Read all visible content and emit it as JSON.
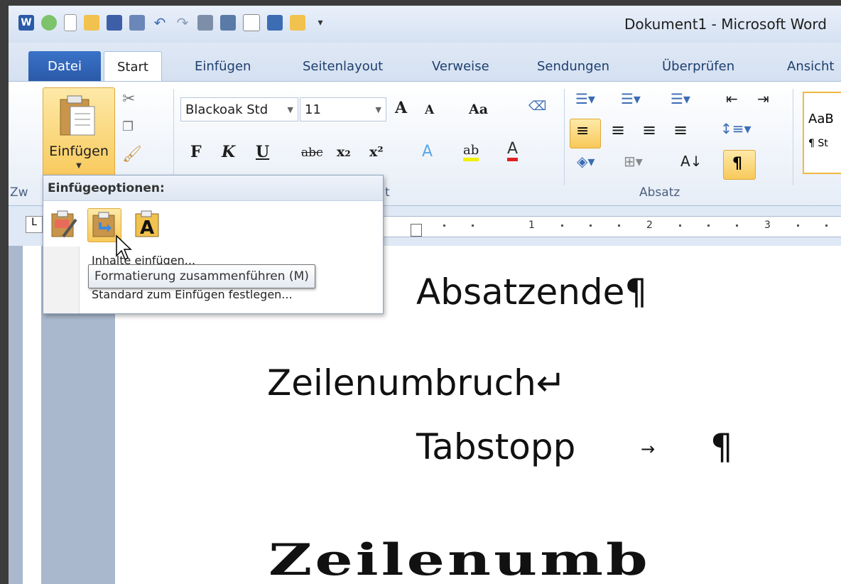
{
  "window": {
    "title": "Dokument1 - Microsoft Word"
  },
  "tabs": {
    "file": "Datei",
    "items": [
      "Start",
      "Einfügen",
      "Seitenlayout",
      "Verweise",
      "Sendungen",
      "Überprüfen",
      "Ansicht"
    ],
    "active": "Start"
  },
  "clipboard": {
    "paste_label": "Einfügen",
    "group_label_partial": "Zw"
  },
  "font": {
    "name": "Blackoak Std",
    "size": "11",
    "bold": "F",
    "italic": "K",
    "underline": "U",
    "strike": "abc",
    "sub": "x₂",
    "sup": "x²",
    "grow": "A",
    "shrink": "A",
    "case": "Aa",
    "group_label_partial": "t"
  },
  "paragraph": {
    "group_label": "Absatz",
    "pilcrow": "¶"
  },
  "styles": {
    "sample": "AaB",
    "name_partial": "¶ St"
  },
  "ruler": {
    "numbers": [
      "1",
      "2",
      "3"
    ]
  },
  "paste_options": {
    "header": "Einfügeoptionen:",
    "line1_partial": "Inhalte einfügen...",
    "line2_partial": "Standard zum Einfügen festlegen...",
    "tooltip": "Formatierung zusammenführen (M)"
  },
  "document": {
    "line1": "Absatzende¶",
    "line2": "Zeilenumbruch↵",
    "line3_word": "Tabstopp",
    "line3_arrow": "→",
    "line3_mark": "¶",
    "line4": "Zeilenumb"
  },
  "colors": {
    "accent": "#2a5aa8",
    "highlight": "#f8c95a"
  }
}
